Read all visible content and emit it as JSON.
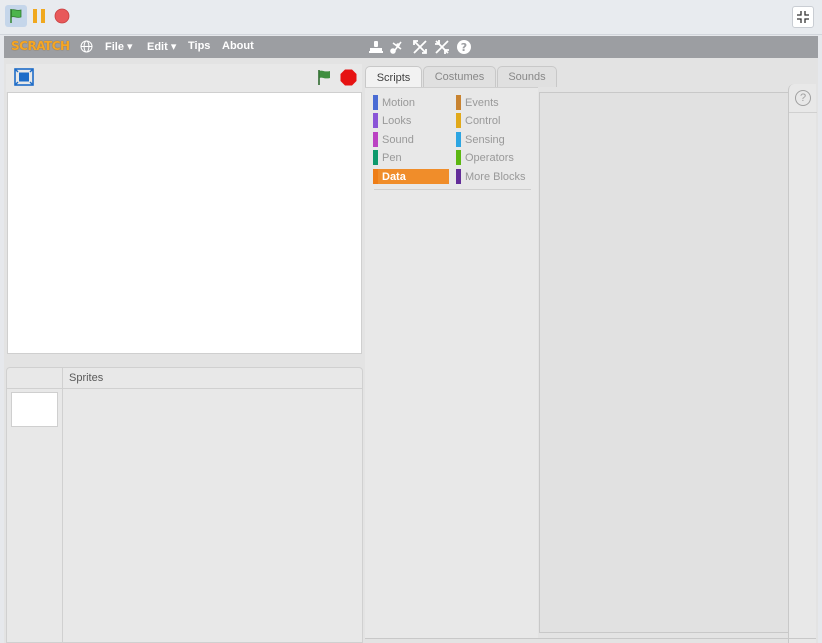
{
  "player_controls": {
    "green_flag": "green-flag-icon",
    "pause": "pause-icon",
    "stop": "stop-icon",
    "exit_fullscreen": "exit-fullscreen-icon"
  },
  "menubar": {
    "logo": "SCRATCH",
    "file": "File ▾",
    "edit": "Edit ▾",
    "tips": "Tips",
    "about": "About"
  },
  "tabs": [
    "Scripts",
    "Costumes",
    "Sounds"
  ],
  "categories": {
    "left": [
      "Motion",
      "Looks",
      "Sound",
      "Pen",
      "Data"
    ],
    "right": [
      "Events",
      "Control",
      "Sensing",
      "Operators",
      "More Blocks"
    ]
  },
  "sprites_panel": {
    "title": "Sprites"
  },
  "colors": {
    "motion": "#4a6cd4",
    "looks": "#8a55d7",
    "sound": "#bb42c3",
    "pen": "#0e9a6c",
    "data": "#ee7d16",
    "events": "#c88330",
    "control": "#e1a91a",
    "sensing": "#2ca5e2",
    "operators": "#5cb712",
    "more_blocks": "#632d99"
  }
}
